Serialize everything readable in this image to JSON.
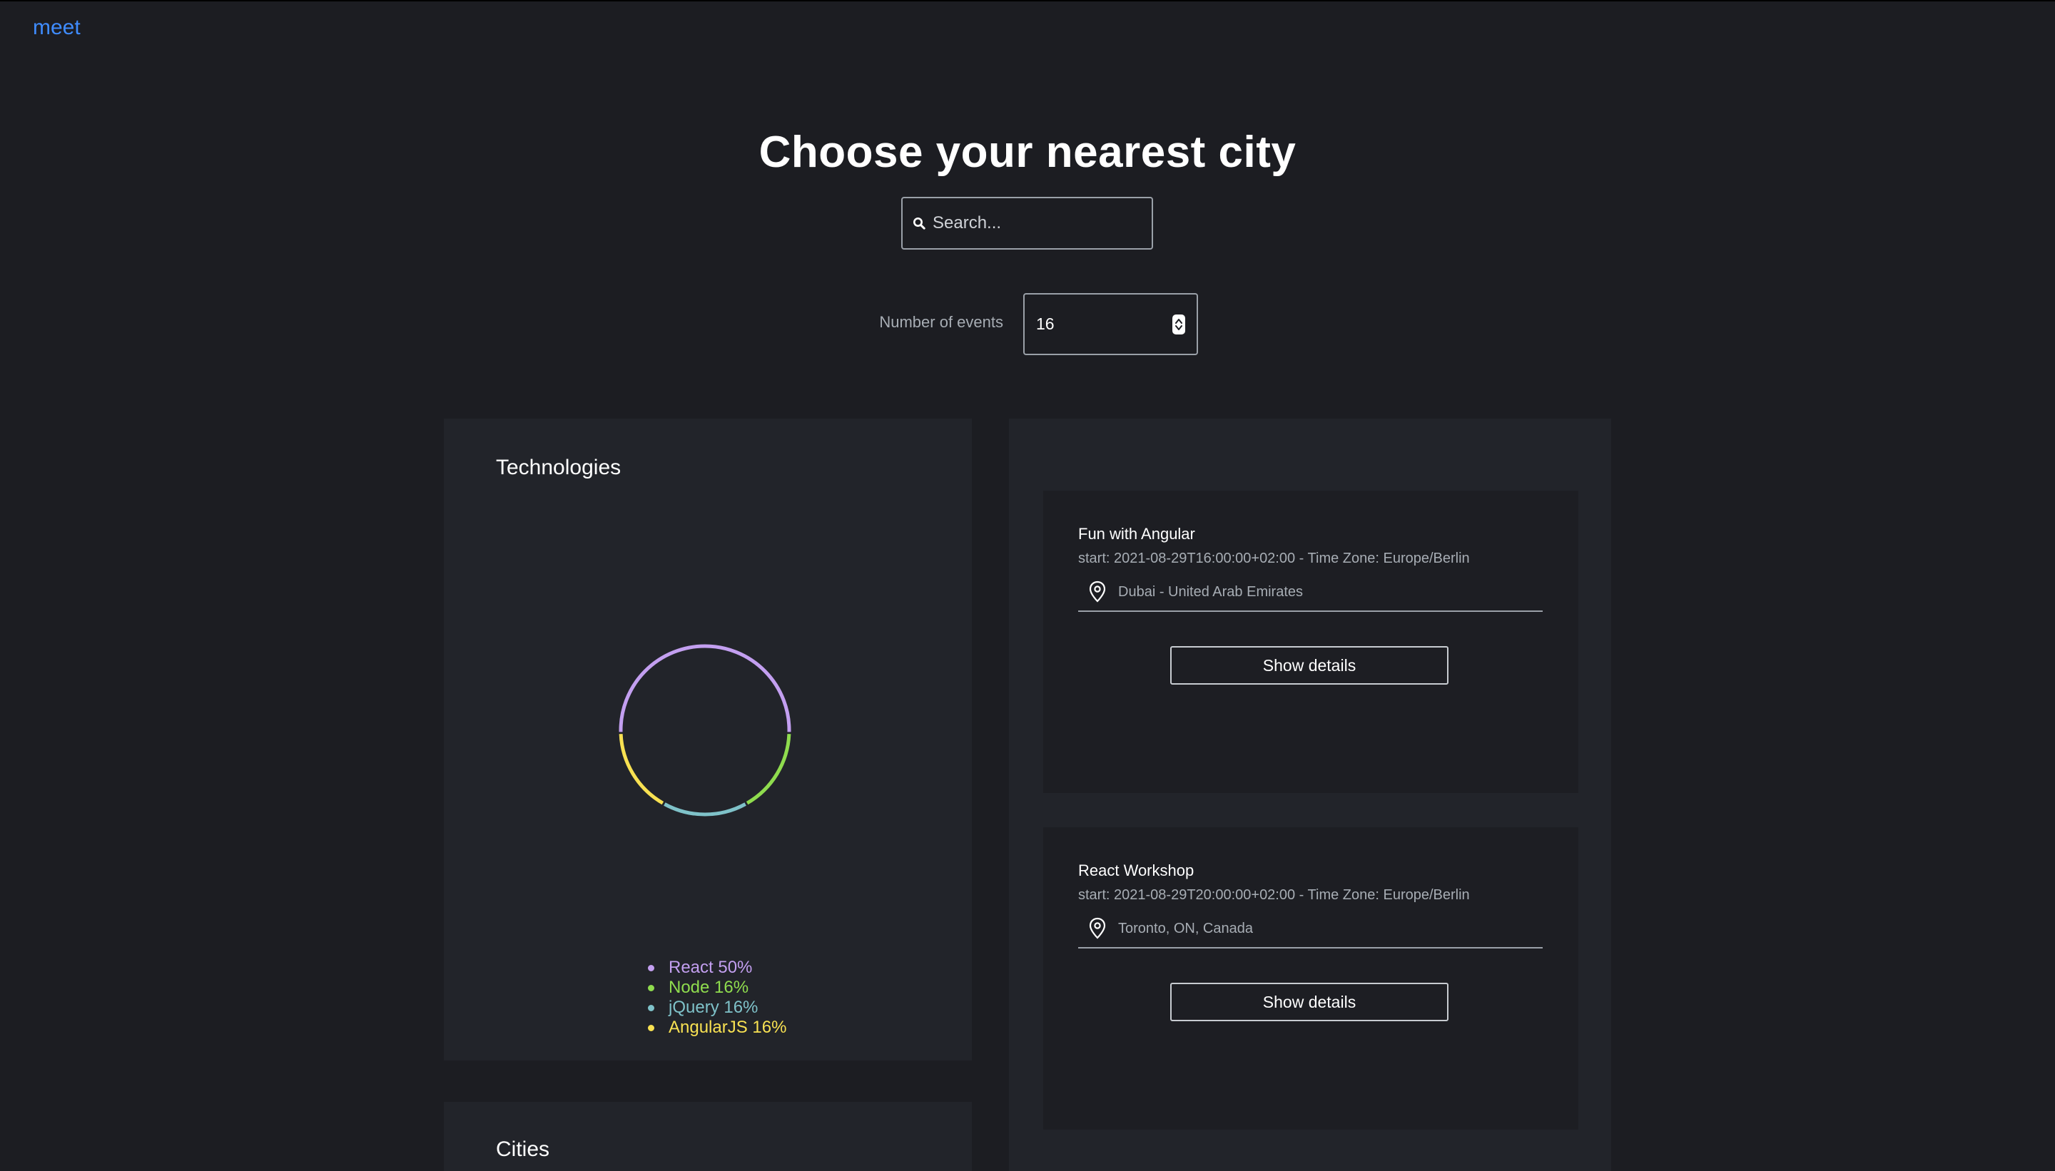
{
  "header": {
    "logo": "meet",
    "title": "Choose your nearest city"
  },
  "search": {
    "placeholder": "Search...",
    "icon": "search-icon"
  },
  "events_count": {
    "label": "Number of events",
    "value": "16"
  },
  "technologies": {
    "title": "Technologies",
    "chart_data": {
      "type": "pie",
      "categories": [
        "React",
        "Node",
        "jQuery",
        "AngularJS"
      ],
      "values": [
        50,
        16,
        16,
        16
      ],
      "colors": [
        "#c39ff0",
        "#8fdc4e",
        "#7fc2c9",
        "#f8e152"
      ],
      "legend_labels": [
        "React 50%",
        "Node 16%",
        "jQuery 16%",
        "AngularJS 16%"
      ],
      "legend_placement": "bottom"
    }
  },
  "cities": {
    "title": "Cities"
  },
  "events": [
    {
      "title": "Fun with Angular",
      "start": "start: 2021-08-29T16:00:00+02:00 - Time Zone: Europe/Berlin",
      "location": "Dubai - United Arab Emirates",
      "button": "Show details"
    },
    {
      "title": "React Workshop",
      "start": "start: 2021-08-29T20:00:00+02:00 - Time Zone: Europe/Berlin",
      "location": "Toronto, ON, Canada",
      "button": "Show details"
    }
  ]
}
